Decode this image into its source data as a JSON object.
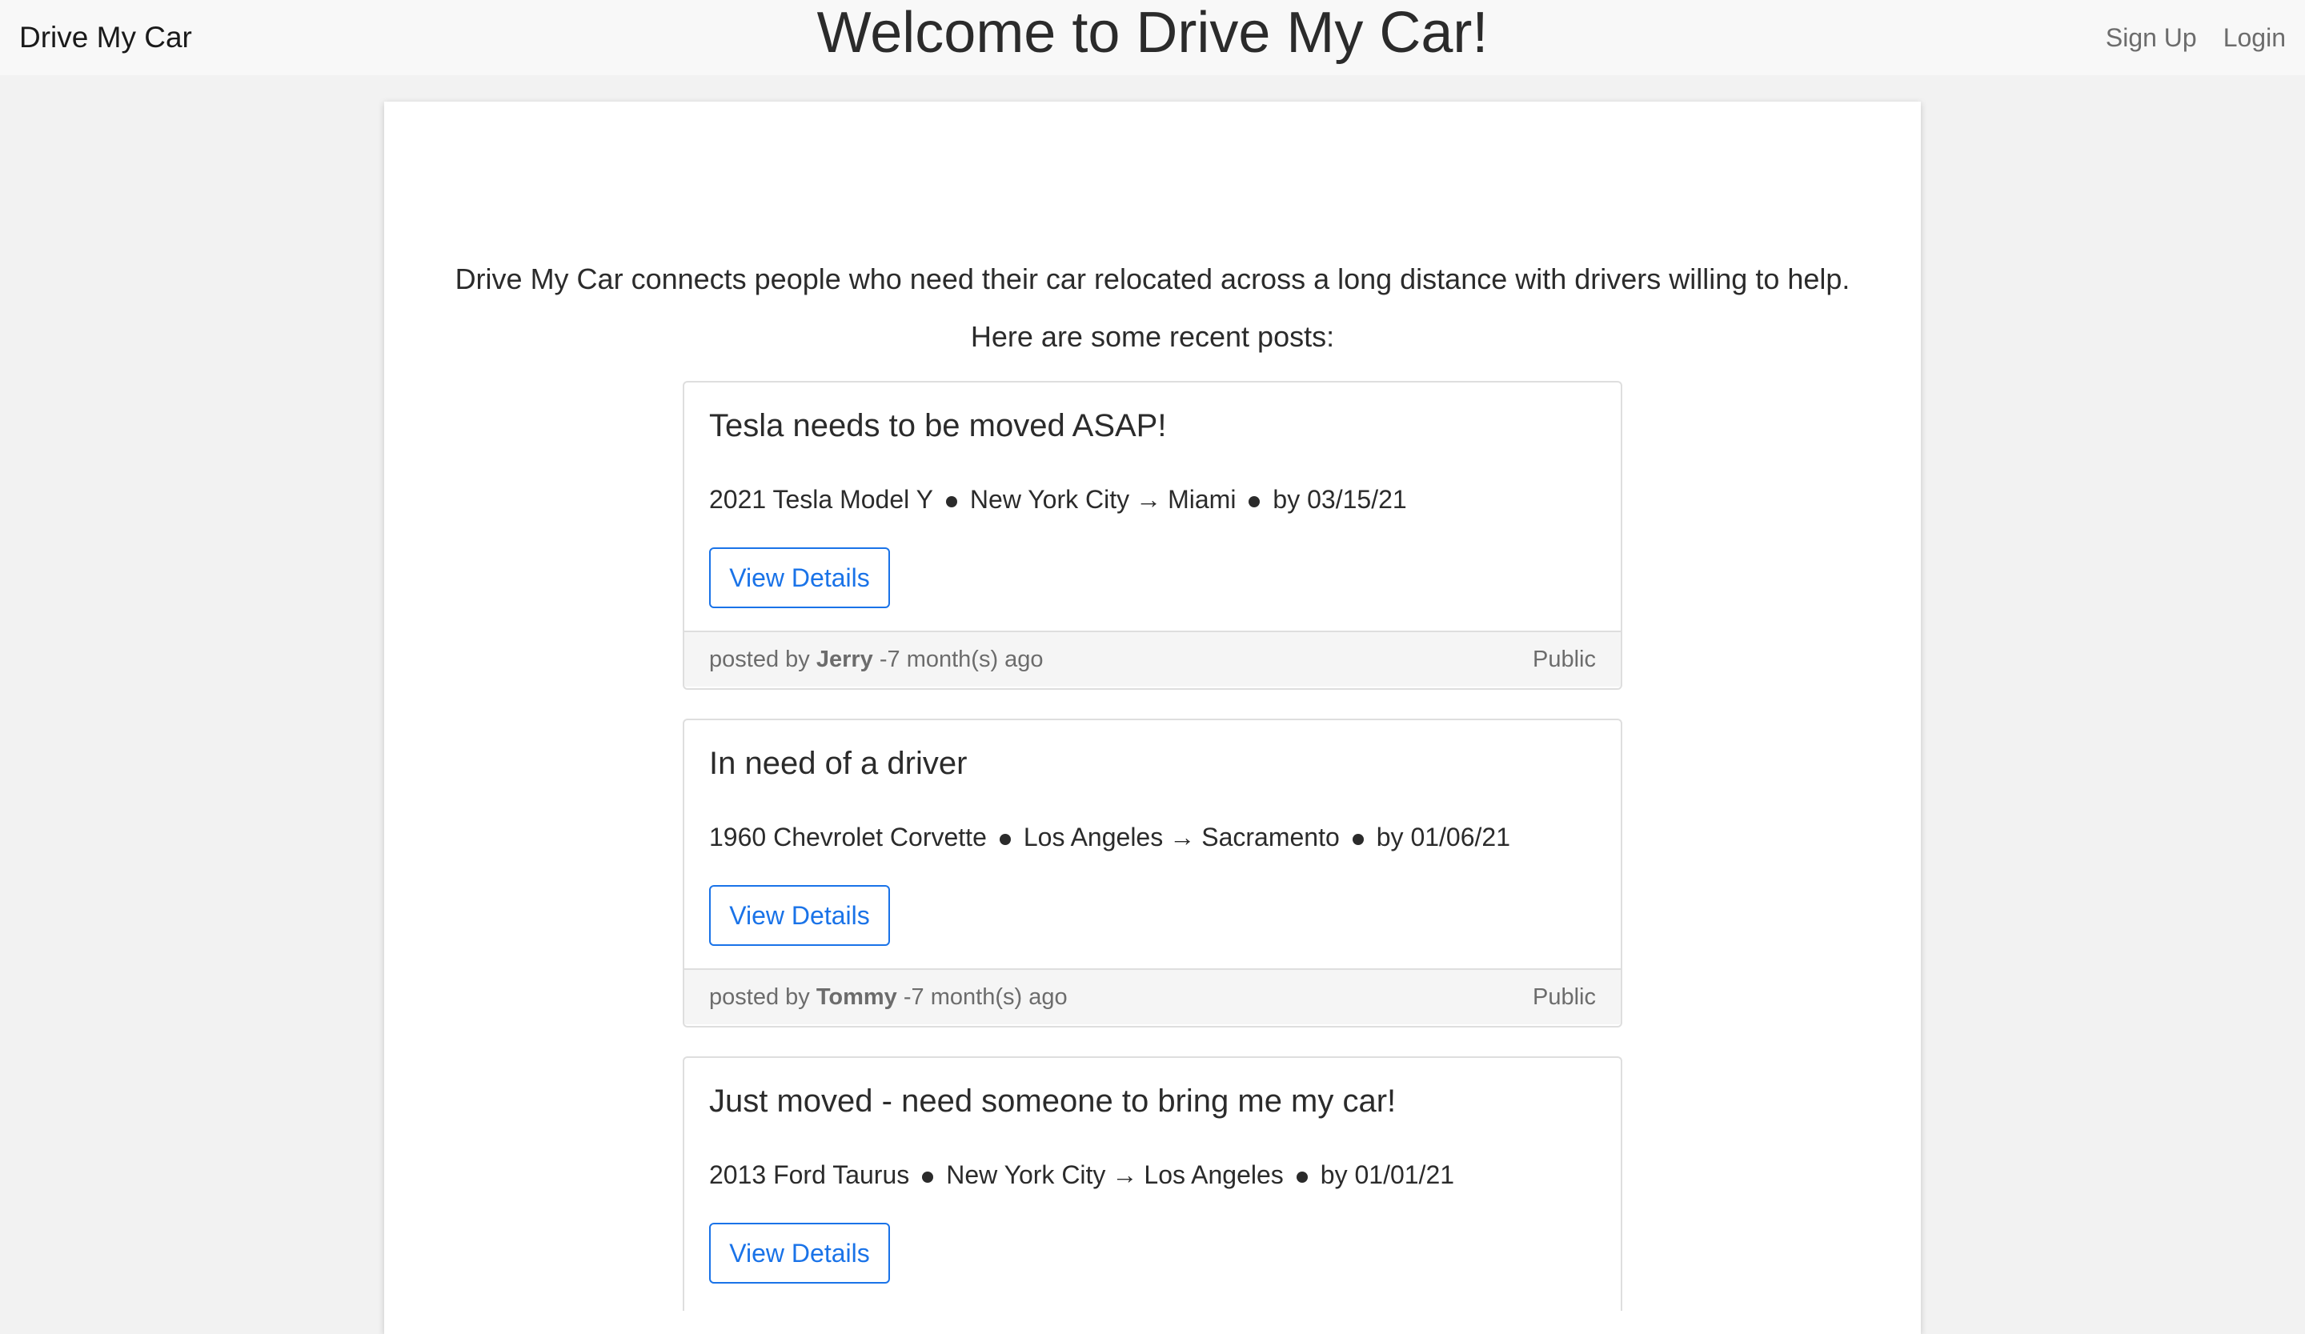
{
  "navbar": {
    "brand": "Drive My Car",
    "signup": "Sign Up",
    "login": "Login"
  },
  "main": {
    "title": "Welcome to Drive My Car!",
    "intro": "Drive My Car connects people who need their car relocated across a long distance with drivers willing to help.",
    "recent_label": "Here are some recent posts:"
  },
  "posts": [
    {
      "title": "Tesla needs to be moved ASAP!",
      "car": "2021 Tesla Model Y",
      "from": "New York City",
      "to": "Miami",
      "deadline": "by 03/15/21",
      "button": "View Details",
      "posted_by": "posted by",
      "author": "Jerry",
      "time": "-7 month(s) ago",
      "visibility": "Public"
    },
    {
      "title": "In need of a driver",
      "car": "1960 Chevrolet Corvette",
      "from": "Los Angeles",
      "to": "Sacramento",
      "deadline": "by 01/06/21",
      "button": "View Details",
      "posted_by": "posted by",
      "author": "Tommy",
      "time": "-7 month(s) ago",
      "visibility": "Public"
    },
    {
      "title": "Just moved - need someone to bring me my car!",
      "car": "2013 Ford Taurus",
      "from": "New York City",
      "to": "Los Angeles",
      "deadline": "by 01/01/21",
      "button": "View Details"
    }
  ],
  "arrow_symbol": "→",
  "colors": {
    "accent": "#1a73e8",
    "background": "#f2f2f2",
    "navbar": "#f8f8f8"
  }
}
